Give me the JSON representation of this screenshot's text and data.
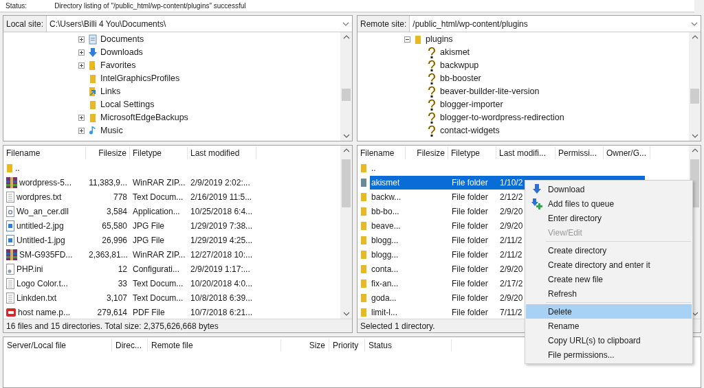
{
  "message_log": {
    "label": "Status:",
    "text": "Directory listing of \"/public_html/wp-content/plugins\" successful"
  },
  "local": {
    "site_label": "Local site:",
    "path": "C:\\Users\\Billi 4 You\\Documents\\",
    "tree": [
      {
        "name": "Documents",
        "kind": "documents",
        "expandable": true
      },
      {
        "name": "Downloads",
        "kind": "download",
        "expandable": true
      },
      {
        "name": "Favorites",
        "kind": "favorites",
        "expandable": true
      },
      {
        "name": "IntelGraphicsProfiles",
        "kind": "folder",
        "expandable": false
      },
      {
        "name": "Links",
        "kind": "link",
        "expandable": false
      },
      {
        "name": "Local Settings",
        "kind": "folder",
        "expandable": false
      },
      {
        "name": "MicrosoftEdgeBackups",
        "kind": "folder",
        "expandable": true
      },
      {
        "name": "Music",
        "kind": "music",
        "expandable": true
      }
    ],
    "columns": [
      "Filename",
      "Filesize",
      "Filetype",
      "Last modified"
    ],
    "files": [
      {
        "kind": "folder",
        "name": ".."
      },
      {
        "kind": "archive",
        "name": "wordpress-5...",
        "size": "11,383,9...",
        "type": "WinRAR ZIP...",
        "modified": "2/9/2019 2:02:..."
      },
      {
        "kind": "text",
        "name": "wordpres.txt",
        "size": "778",
        "type": "Text Docum...",
        "modified": "2/16/2019 11:5..."
      },
      {
        "kind": "dll",
        "name": "Wo_an_cer.dll",
        "size": "3,584",
        "type": "Application...",
        "modified": "10/25/2018 6:4..."
      },
      {
        "kind": "image",
        "name": "untitled-2.jpg",
        "size": "65,580",
        "type": "JPG File",
        "modified": "1/29/2019 7:38..."
      },
      {
        "kind": "image",
        "name": "Untitled-1.jpg",
        "size": "26,996",
        "type": "JPG File",
        "modified": "1/29/2019 4:25..."
      },
      {
        "kind": "archive",
        "name": "SM-G935FD...",
        "size": "2,363,81...",
        "type": "WinRAR ZIP...",
        "modified": "12/27/2018 10:..."
      },
      {
        "kind": "config",
        "name": "PHP.ini",
        "size": "12",
        "type": "Configurati...",
        "modified": "2/9/2019 1:17:..."
      },
      {
        "kind": "text",
        "name": "Logo Color.t...",
        "size": "33",
        "type": "Text Docum...",
        "modified": "10/20/2018 4:0..."
      },
      {
        "kind": "text",
        "name": "Linkden.txt",
        "size": "3,107",
        "type": "Text Docum...",
        "modified": "10/8/2018 6:39..."
      },
      {
        "kind": "pdf",
        "name": "host name.p...",
        "size": "279,614",
        "type": "PDF File",
        "modified": "10/7/2018 6:21..."
      }
    ],
    "status": "16 files and 15 directories. Total size: 2,375,626,668 bytes"
  },
  "remote": {
    "site_label": "Remote site:",
    "path": "/public_html/wp-content/plugins",
    "tree": {
      "name": "plugins",
      "expanded": true,
      "children": [
        "akismet",
        "backwpup",
        "bb-booster",
        "beaver-builder-lite-version",
        "blogger-importer",
        "blogger-to-wordpress-redirection",
        "contact-widgets"
      ]
    },
    "columns": [
      "Filename",
      "Filesize",
      "Filetype",
      "Last modifi...",
      "Permissi...",
      "Owner/G..."
    ],
    "files": [
      {
        "name": "..",
        "selected": false
      },
      {
        "name": "akismet",
        "type": "File folder",
        "modified": "1/10/2",
        "selected": true
      },
      {
        "name": "backw...",
        "type": "File folder",
        "modified": "2/12/2",
        "selected": false
      },
      {
        "name": "bb-bo...",
        "type": "File folder",
        "modified": "2/9/20",
        "selected": false
      },
      {
        "name": "beave...",
        "type": "File folder",
        "modified": "2/9/20",
        "selected": false
      },
      {
        "name": "blogg...",
        "type": "File folder",
        "modified": "2/11/2",
        "selected": false
      },
      {
        "name": "blogg...",
        "type": "File folder",
        "modified": "2/11/2",
        "selected": false
      },
      {
        "name": "conta...",
        "type": "File folder",
        "modified": "2/9/20",
        "selected": false
      },
      {
        "name": "fix-an...",
        "type": "File folder",
        "modified": "2/17/2",
        "selected": false
      },
      {
        "name": "goda...",
        "type": "File folder",
        "modified": "2/9/20",
        "selected": false
      },
      {
        "name": "limit-l...",
        "type": "File folder",
        "modified": "7/11/2",
        "selected": false
      }
    ],
    "status": "Selected 1 directory."
  },
  "queue": {
    "columns": [
      "Server/Local file",
      "Direc...",
      "Remote file",
      "Size",
      "Priority",
      "Status"
    ]
  },
  "context_menu": [
    {
      "kind": "item",
      "label": "Download",
      "disabled": false,
      "selected": false
    },
    {
      "kind": "item",
      "label": "Add files to queue",
      "disabled": false,
      "selected": false
    },
    {
      "kind": "item",
      "label": "Enter directory",
      "disabled": false,
      "selected": false
    },
    {
      "kind": "item",
      "label": "View/Edit",
      "disabled": true,
      "selected": false
    },
    {
      "kind": "separator"
    },
    {
      "kind": "item",
      "label": "Create directory",
      "disabled": false,
      "selected": false
    },
    {
      "kind": "item",
      "label": "Create directory and enter it",
      "disabled": false,
      "selected": false
    },
    {
      "kind": "item",
      "label": "Create new file",
      "disabled": false,
      "selected": false
    },
    {
      "kind": "item",
      "label": "Refresh",
      "disabled": false,
      "selected": false
    },
    {
      "kind": "separator"
    },
    {
      "kind": "item",
      "label": "Delete",
      "disabled": false,
      "selected": true
    },
    {
      "kind": "item",
      "label": "Rename",
      "disabled": false,
      "selected": false
    },
    {
      "kind": "item",
      "label": "Copy URL(s) to clipboard",
      "disabled": false,
      "selected": false
    },
    {
      "kind": "item",
      "label": "File permissions...",
      "disabled": false,
      "selected": false
    }
  ]
}
